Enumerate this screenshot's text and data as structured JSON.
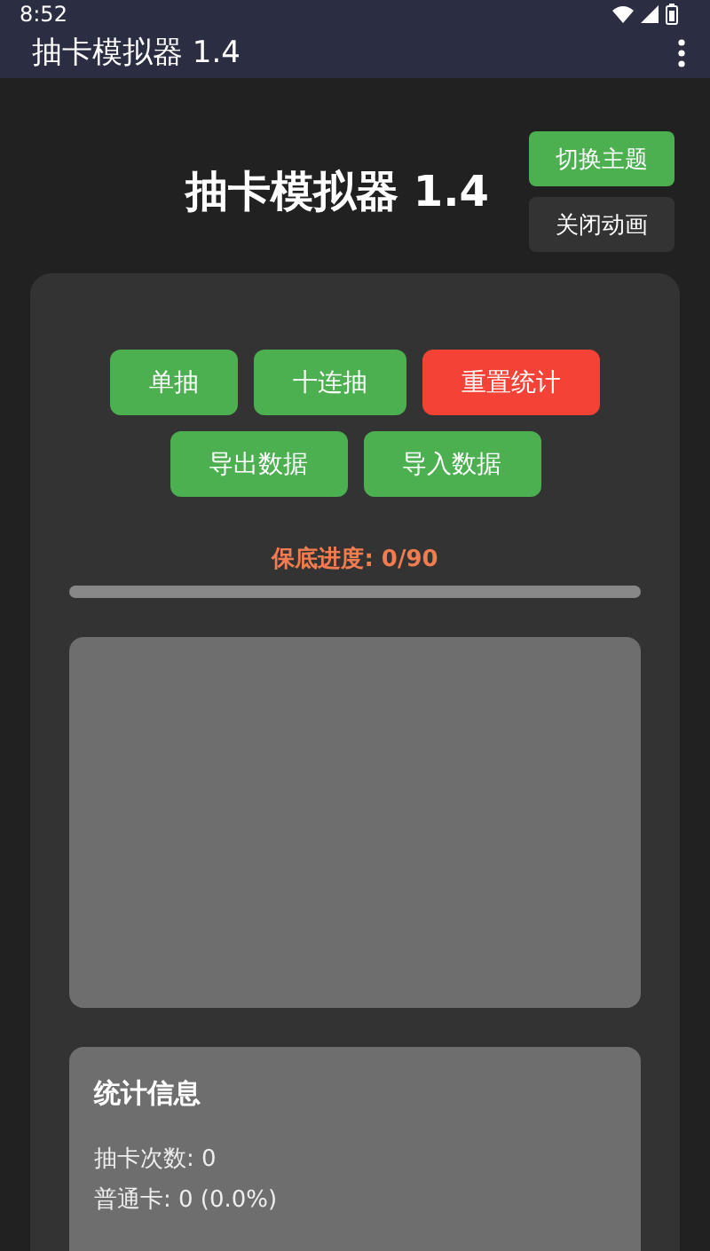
{
  "status_bar": {
    "time": "8:52"
  },
  "app_bar": {
    "title": "抽卡模拟器 1.4"
  },
  "header": {
    "title": "抽卡模拟器 1.4",
    "buttons": [
      {
        "label": "切换主题",
        "kind": "green"
      },
      {
        "label": "关闭动画",
        "kind": "dark"
      }
    ]
  },
  "actions": [
    [
      {
        "label": "单抽",
        "kind": "green"
      },
      {
        "label": "十连抽",
        "kind": "green"
      },
      {
        "label": "重置统计",
        "kind": "red"
      }
    ],
    [
      {
        "label": "导出数据",
        "kind": "green"
      },
      {
        "label": "导入数据",
        "kind": "green"
      }
    ]
  ],
  "pity": {
    "label": "保底进度: 0/90",
    "level": 0
  },
  "stats": {
    "title": "统计信息",
    "lines": [
      "抽卡次数: 0",
      "普通卡: 0 (0.0%)"
    ]
  }
}
